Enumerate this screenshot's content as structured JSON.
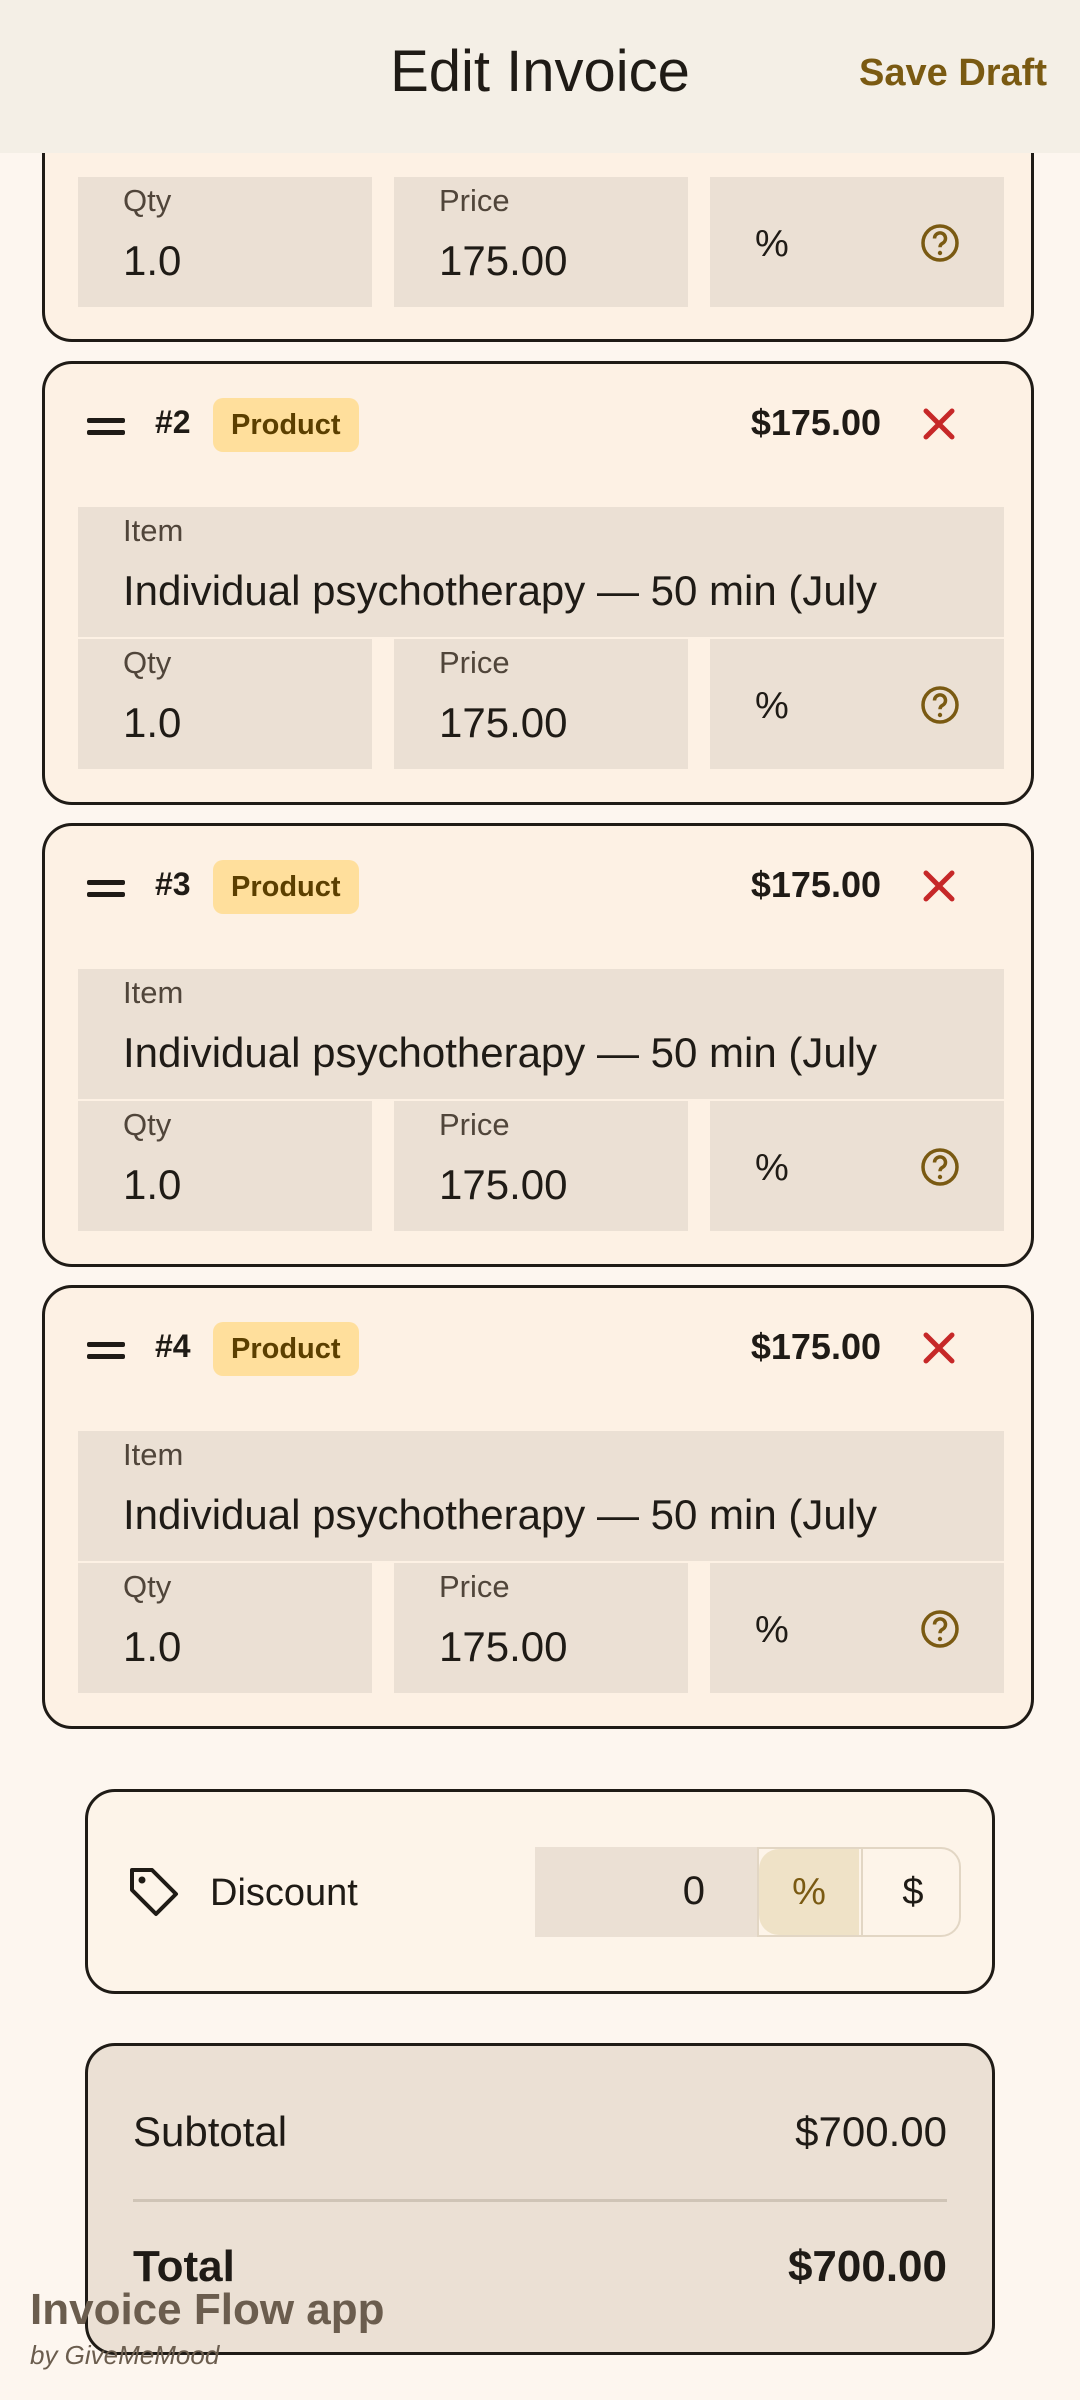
{
  "header": {
    "title": "Edit Invoice",
    "save_label": "Save Draft"
  },
  "labels": {
    "item": "Item",
    "qty": "Qty",
    "price": "Price",
    "percent": "%"
  },
  "first_item": {
    "qty": "1.0",
    "price": "175.00"
  },
  "items": [
    {
      "number": "#2",
      "type": "Product",
      "total": "$175.00",
      "name": "Individual psychotherapy — 50 min (July",
      "qty": "1.0",
      "price": "175.00"
    },
    {
      "number": "#3",
      "type": "Product",
      "total": "$175.00",
      "name": "Individual psychotherapy — 50 min (July",
      "qty": "1.0",
      "price": "175.00"
    },
    {
      "number": "#4",
      "type": "Product",
      "total": "$175.00",
      "name": "Individual psychotherapy — 50 min (July",
      "qty": "1.0",
      "price": "175.00"
    }
  ],
  "discount": {
    "label": "Discount",
    "value": "0",
    "percent_option": "%",
    "dollar_option": "$",
    "selected": "%"
  },
  "totals": {
    "subtotal_label": "Subtotal",
    "subtotal_value": "$700.00",
    "total_label": "Total",
    "total_value": "$700.00"
  },
  "watermark": {
    "title": "Invoice Flow app",
    "subtitle": "by GiveMeMood"
  },
  "colors": {
    "accent": "#7a5a12",
    "badge_bg": "#ffdf9c",
    "remove": "#c62828",
    "field_bg": "#ebe0d4"
  }
}
